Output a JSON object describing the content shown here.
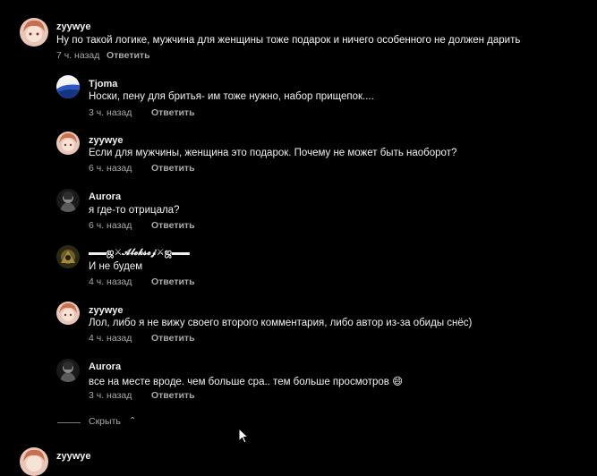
{
  "comments": [
    {
      "author": "zyywye",
      "text": "Ну по такой логике, мужчина для женщины тоже подарок и ничего особенного не должен дарить",
      "time": "7 ч. назад",
      "reply": "Ответить"
    },
    {
      "author": "Tjoma",
      "text": "Носки, пену для бритья- им тоже нужно, набор прищепок....",
      "time": "3 ч. назад",
      "reply": "Ответить"
    },
    {
      "author": "zyywye",
      "text": "Если для мужчины, женщина это подарок. Почему не может быть наоборот?",
      "time": "6 ч. назад",
      "reply": "Ответить"
    },
    {
      "author": "Aurora",
      "text": "я где-то отрицала?",
      "time": "6 ч. назад",
      "reply": "Ответить"
    },
    {
      "author": "▬▬ஜ⚔𝓐𝓵𝓮𝓴𝓼𝓮𝓳⚔ஜ▬▬",
      "text": "И не будем",
      "time": "4 ч. назад",
      "reply": "Ответить"
    },
    {
      "author": "zyywye",
      "text": "Лол, либо я не вижу своего второго комментария, либо автор из-за обиды снёс)",
      "time": "4 ч. назад",
      "reply": "Ответить"
    },
    {
      "author": "Aurora",
      "text": "все на месте вроде. чем больше сра.. тем больше просмотров 😄",
      "time": "3 ч. назад",
      "reply": "Ответить"
    },
    {
      "author": "zyywye"
    }
  ],
  "hide_label": "Скрыть",
  "colors": {
    "background": "#000000",
    "text": "#f1f1f1",
    "muted": "#aaaaaa"
  }
}
